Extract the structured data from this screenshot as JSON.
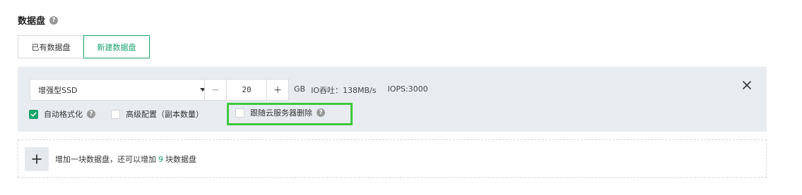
{
  "section": {
    "title": "数据盘",
    "help": "?"
  },
  "tabs": [
    {
      "label": "已有数据盘",
      "active": false
    },
    {
      "label": "新建数据盘",
      "active": true
    }
  ],
  "disk": {
    "type_value": "增强型SSD",
    "size_value": "20",
    "minus_label": "−",
    "plus_label": "+",
    "unit": "GB",
    "io_throughput": "IO吞吐：138MB/s",
    "iops": "IOPS:3000"
  },
  "options": {
    "auto_format": {
      "label": "自动格式化",
      "checked": true
    },
    "advanced": {
      "label": "高级配置（副本数量）",
      "checked": false
    },
    "follow_delete": {
      "label": "跟随云服务器删除",
      "checked": false
    }
  },
  "add": {
    "prefix": "增加一块数据盘，还可以增加",
    "count": "9",
    "suffix": "块数据盘"
  },
  "colors": {
    "accent": "#1aa36a",
    "highlight": "#3ec83e",
    "panel_bg": "#e8ecf1"
  }
}
